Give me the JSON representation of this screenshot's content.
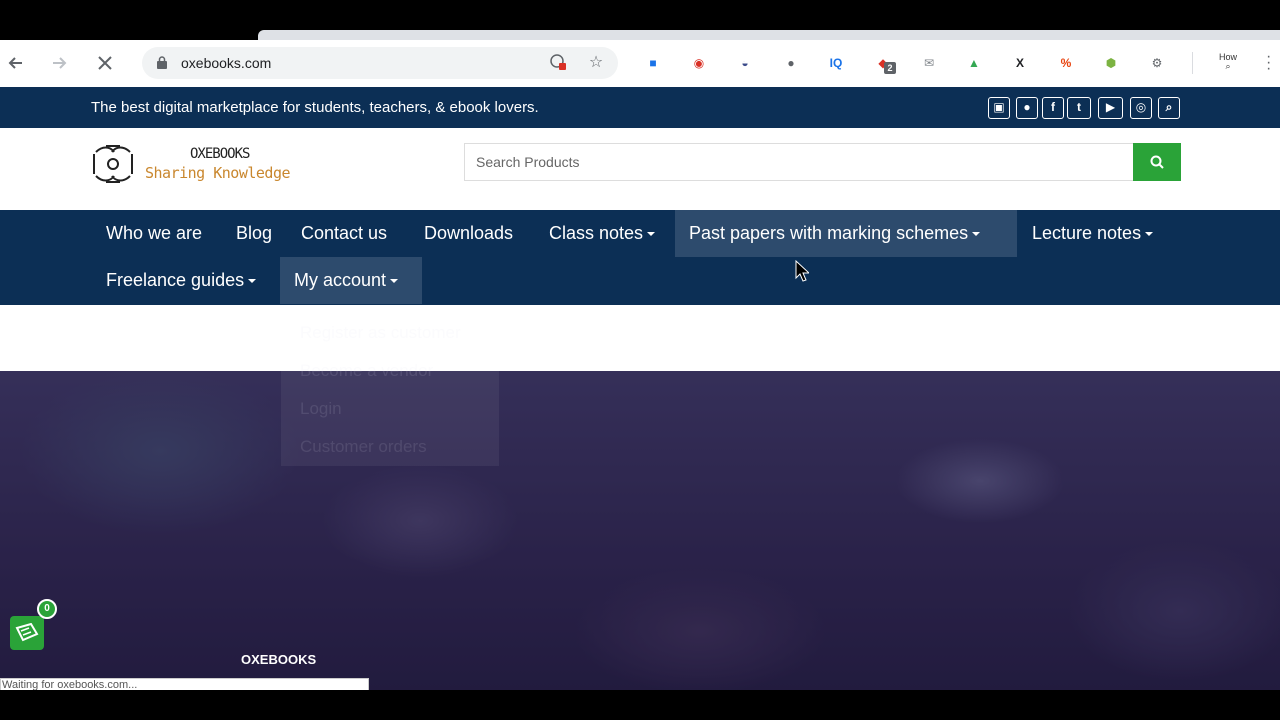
{
  "browser": {
    "url": "oxebooks.com",
    "nav": [
      "back-icon",
      "forward-icon",
      "stop-loading-icon"
    ],
    "extensions": [
      {
        "name": "ext-blue-icon",
        "color": "#1a73e8",
        "glyph": "■"
      },
      {
        "name": "ext-red-icon",
        "color": "#d93025",
        "glyph": "◉"
      },
      {
        "name": "ext-navy-icon",
        "color": "#3b4b8a",
        "glyph": "◒"
      },
      {
        "name": "ext-leaf-icon",
        "color": "#5f6368",
        "glyph": "●"
      },
      {
        "name": "ext-iq-icon",
        "color": "#1a73e8",
        "glyph": "IQ"
      },
      {
        "name": "ext-shield-icon",
        "color": "#d93025",
        "glyph": "◆",
        "badge": "2"
      },
      {
        "name": "ext-mail-icon",
        "color": "#80868b",
        "glyph": "✉"
      },
      {
        "name": "ext-inbox-icon",
        "color": "#34a853",
        "glyph": "▲"
      },
      {
        "name": "ext-x-icon",
        "color": "#202124",
        "glyph": "X"
      },
      {
        "name": "ext-percent-icon",
        "color": "#e8430f",
        "glyph": "%"
      },
      {
        "name": "ext-cube-icon",
        "color": "#7cb342",
        "glyph": "⬢"
      },
      {
        "name": "ext-gear-icon",
        "color": "#5f6368",
        "glyph": "⚙"
      }
    ],
    "profile_label": "How",
    "status_text": "Waiting for oxebooks.com..."
  },
  "site": {
    "tagline": "The best digital marketplace for students, teachers, & ebook lovers.",
    "social_icons": [
      "bag-icon",
      "user-icon",
      "facebook-icon",
      "twitter-icon",
      "youtube-icon",
      "whatsapp-icon",
      "search-icon"
    ],
    "logo_title": "OXEBOOKS",
    "logo_subtitle": "Sharing Knowledge",
    "search_placeholder": "Search Products",
    "nav": [
      {
        "label": "Who we are",
        "dropdown": false
      },
      {
        "label": "Blog",
        "dropdown": false
      },
      {
        "label": "Contact us",
        "dropdown": false
      },
      {
        "label": "Downloads",
        "dropdown": false
      },
      {
        "label": "Class notes",
        "dropdown": true
      },
      {
        "label": "Past papers with marking schemes",
        "dropdown": true
      },
      {
        "label": "Lecture notes",
        "dropdown": true
      },
      {
        "label": "Freelance guides",
        "dropdown": true
      },
      {
        "label": "My account",
        "dropdown": true
      }
    ],
    "account_menu": [
      "Register as customer",
      "Become a vendor",
      "Login",
      "Customer orders"
    ],
    "hero_brand": "OXEBOOKS",
    "cart_count": "0",
    "colors": {
      "navy": "#0c2f55",
      "green": "#2aa338",
      "gold": "#c9872e"
    }
  }
}
